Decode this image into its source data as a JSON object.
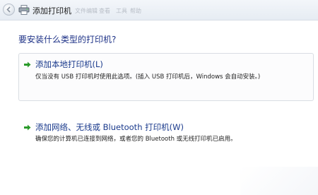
{
  "window": {
    "title": "添加打印机",
    "ghost_menu": [
      "文件",
      "编辑",
      "查看",
      "工具",
      "帮助"
    ]
  },
  "main": {
    "heading": "要安装什么类型的打印机?",
    "options": [
      {
        "title": "添加本地打印机(L)",
        "description": "仅当没有 USB 打印机时使用此选项。(插入 USB 打印机后，Windows 会自动安装。)"
      },
      {
        "title": "添加网络、无线或 Bluetooth 打印机(W)",
        "description": "确保您的计算机已连接到网络，或者您的 Bluetooth 或无线打印机已启用。"
      }
    ]
  },
  "colors": {
    "arrow_green": "#2a9a2a",
    "link_blue": "#1a3a8c",
    "heading_blue": "#1e3287"
  },
  "icons": {
    "back": "back-arrow-icon",
    "printer": "printer-icon",
    "option_arrow": "green-arrow-icon"
  }
}
